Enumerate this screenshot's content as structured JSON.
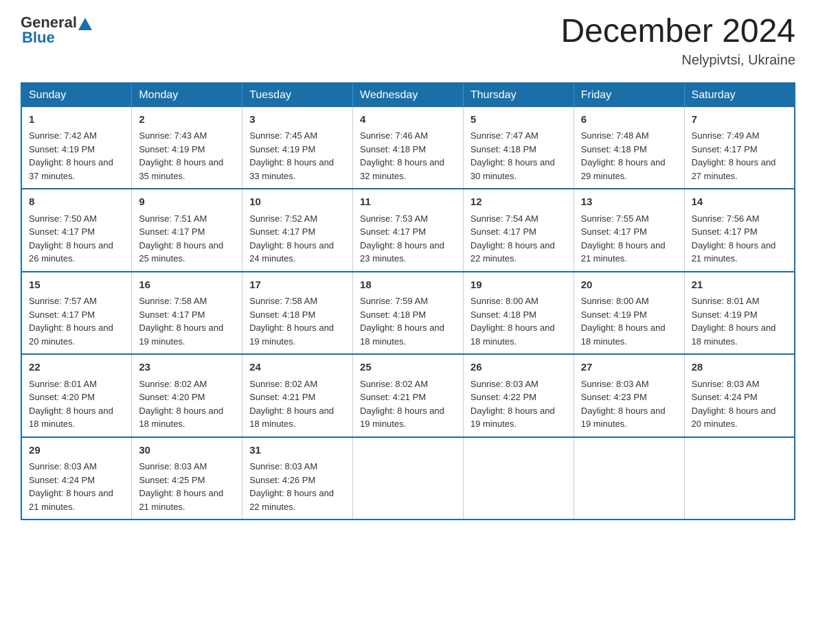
{
  "header": {
    "logo_general": "General",
    "logo_blue": "Blue",
    "month_year": "December 2024",
    "location": "Nelypivtsi, Ukraine"
  },
  "weekdays": [
    "Sunday",
    "Monday",
    "Tuesday",
    "Wednesday",
    "Thursday",
    "Friday",
    "Saturday"
  ],
  "weeks": [
    [
      {
        "day": "1",
        "sunrise": "7:42 AM",
        "sunset": "4:19 PM",
        "daylight": "8 hours and 37 minutes."
      },
      {
        "day": "2",
        "sunrise": "7:43 AM",
        "sunset": "4:19 PM",
        "daylight": "8 hours and 35 minutes."
      },
      {
        "day": "3",
        "sunrise": "7:45 AM",
        "sunset": "4:19 PM",
        "daylight": "8 hours and 33 minutes."
      },
      {
        "day": "4",
        "sunrise": "7:46 AM",
        "sunset": "4:18 PM",
        "daylight": "8 hours and 32 minutes."
      },
      {
        "day": "5",
        "sunrise": "7:47 AM",
        "sunset": "4:18 PM",
        "daylight": "8 hours and 30 minutes."
      },
      {
        "day": "6",
        "sunrise": "7:48 AM",
        "sunset": "4:18 PM",
        "daylight": "8 hours and 29 minutes."
      },
      {
        "day": "7",
        "sunrise": "7:49 AM",
        "sunset": "4:17 PM",
        "daylight": "8 hours and 27 minutes."
      }
    ],
    [
      {
        "day": "8",
        "sunrise": "7:50 AM",
        "sunset": "4:17 PM",
        "daylight": "8 hours and 26 minutes."
      },
      {
        "day": "9",
        "sunrise": "7:51 AM",
        "sunset": "4:17 PM",
        "daylight": "8 hours and 25 minutes."
      },
      {
        "day": "10",
        "sunrise": "7:52 AM",
        "sunset": "4:17 PM",
        "daylight": "8 hours and 24 minutes."
      },
      {
        "day": "11",
        "sunrise": "7:53 AM",
        "sunset": "4:17 PM",
        "daylight": "8 hours and 23 minutes."
      },
      {
        "day": "12",
        "sunrise": "7:54 AM",
        "sunset": "4:17 PM",
        "daylight": "8 hours and 22 minutes."
      },
      {
        "day": "13",
        "sunrise": "7:55 AM",
        "sunset": "4:17 PM",
        "daylight": "8 hours and 21 minutes."
      },
      {
        "day": "14",
        "sunrise": "7:56 AM",
        "sunset": "4:17 PM",
        "daylight": "8 hours and 21 minutes."
      }
    ],
    [
      {
        "day": "15",
        "sunrise": "7:57 AM",
        "sunset": "4:17 PM",
        "daylight": "8 hours and 20 minutes."
      },
      {
        "day": "16",
        "sunrise": "7:58 AM",
        "sunset": "4:17 PM",
        "daylight": "8 hours and 19 minutes."
      },
      {
        "day": "17",
        "sunrise": "7:58 AM",
        "sunset": "4:18 PM",
        "daylight": "8 hours and 19 minutes."
      },
      {
        "day": "18",
        "sunrise": "7:59 AM",
        "sunset": "4:18 PM",
        "daylight": "8 hours and 18 minutes."
      },
      {
        "day": "19",
        "sunrise": "8:00 AM",
        "sunset": "4:18 PM",
        "daylight": "8 hours and 18 minutes."
      },
      {
        "day": "20",
        "sunrise": "8:00 AM",
        "sunset": "4:19 PM",
        "daylight": "8 hours and 18 minutes."
      },
      {
        "day": "21",
        "sunrise": "8:01 AM",
        "sunset": "4:19 PM",
        "daylight": "8 hours and 18 minutes."
      }
    ],
    [
      {
        "day": "22",
        "sunrise": "8:01 AM",
        "sunset": "4:20 PM",
        "daylight": "8 hours and 18 minutes."
      },
      {
        "day": "23",
        "sunrise": "8:02 AM",
        "sunset": "4:20 PM",
        "daylight": "8 hours and 18 minutes."
      },
      {
        "day": "24",
        "sunrise": "8:02 AM",
        "sunset": "4:21 PM",
        "daylight": "8 hours and 18 minutes."
      },
      {
        "day": "25",
        "sunrise": "8:02 AM",
        "sunset": "4:21 PM",
        "daylight": "8 hours and 19 minutes."
      },
      {
        "day": "26",
        "sunrise": "8:03 AM",
        "sunset": "4:22 PM",
        "daylight": "8 hours and 19 minutes."
      },
      {
        "day": "27",
        "sunrise": "8:03 AM",
        "sunset": "4:23 PM",
        "daylight": "8 hours and 19 minutes."
      },
      {
        "day": "28",
        "sunrise": "8:03 AM",
        "sunset": "4:24 PM",
        "daylight": "8 hours and 20 minutes."
      }
    ],
    [
      {
        "day": "29",
        "sunrise": "8:03 AM",
        "sunset": "4:24 PM",
        "daylight": "8 hours and 21 minutes."
      },
      {
        "day": "30",
        "sunrise": "8:03 AM",
        "sunset": "4:25 PM",
        "daylight": "8 hours and 21 minutes."
      },
      {
        "day": "31",
        "sunrise": "8:03 AM",
        "sunset": "4:26 PM",
        "daylight": "8 hours and 22 minutes."
      },
      null,
      null,
      null,
      null
    ]
  ],
  "labels": {
    "sunrise": "Sunrise:",
    "sunset": "Sunset:",
    "daylight": "Daylight:"
  }
}
